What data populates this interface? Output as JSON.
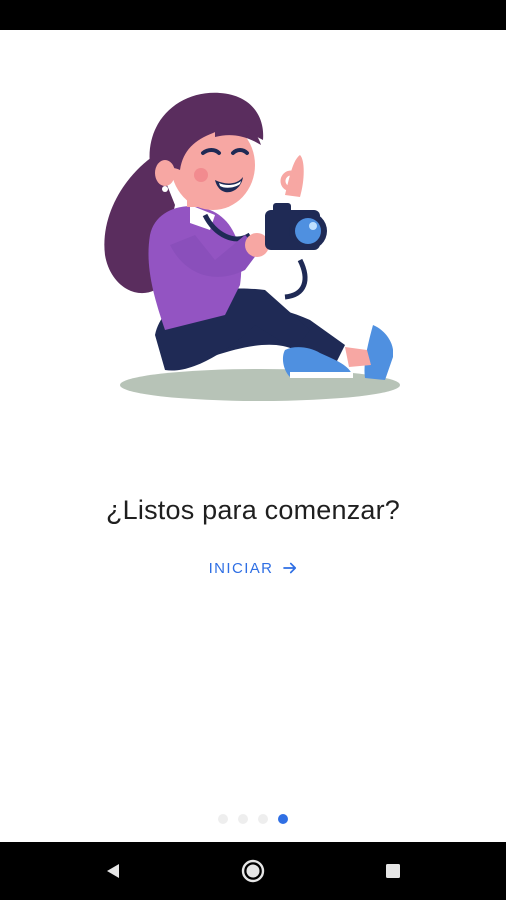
{
  "onboarding": {
    "headline": "¿Listos para comenzar?",
    "start_label": "INICIAR",
    "start_icon": "arrow-right-icon",
    "page_indicator": {
      "total": 4,
      "active_index": 3
    }
  },
  "nav_bar": {
    "buttons": [
      "back-icon",
      "home-icon",
      "recents-icon"
    ]
  },
  "colors": {
    "accent": "#2f6fe4",
    "text": "#1f1f1f",
    "system_bars": "#000000",
    "dot_inactive": "#eeeeee"
  }
}
